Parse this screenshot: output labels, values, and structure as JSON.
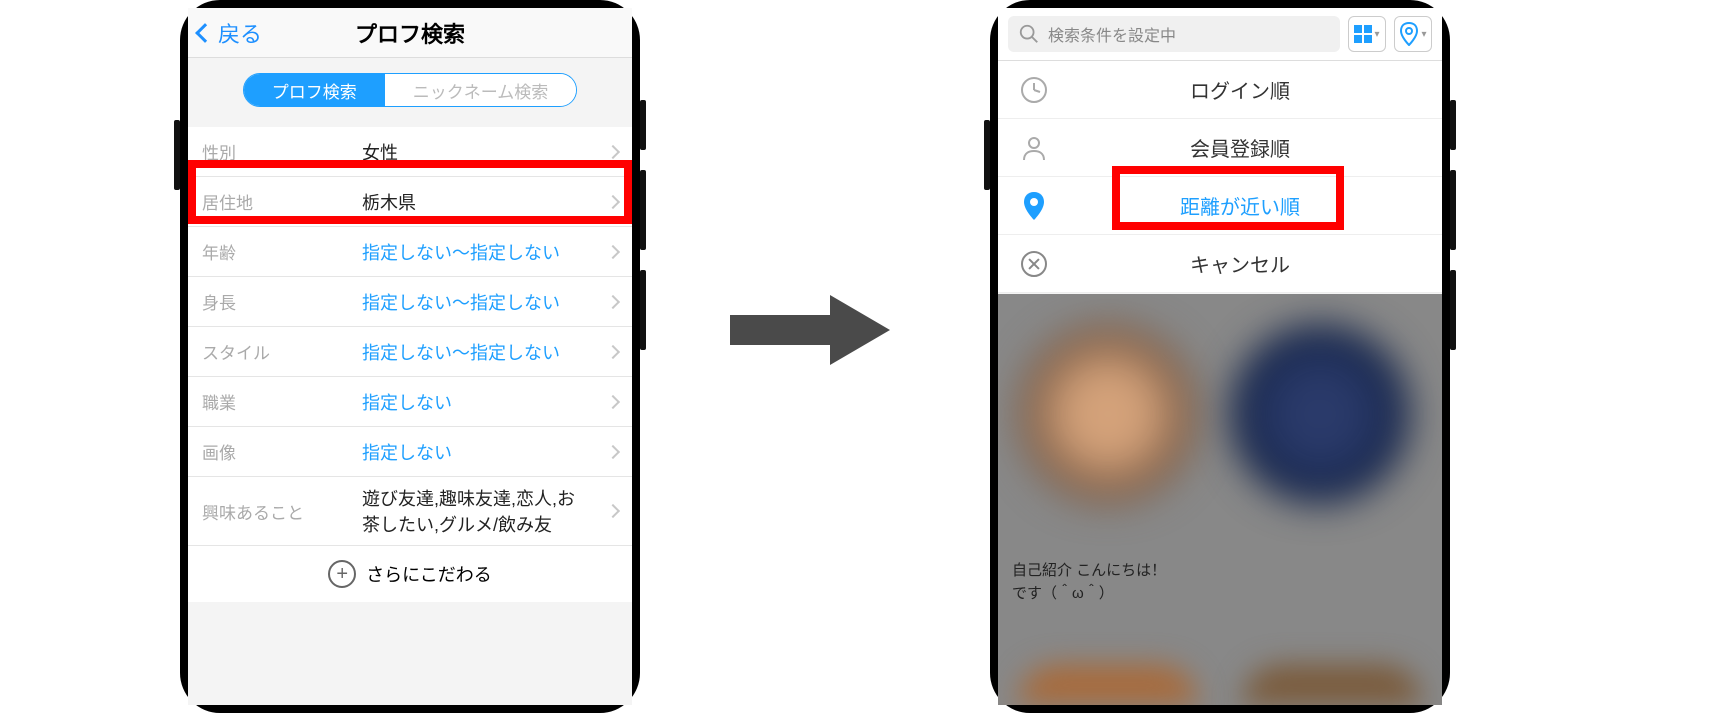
{
  "left": {
    "nav": {
      "back": "戻る",
      "title": "プロフ検索"
    },
    "segments": {
      "profile": "プロフ検索",
      "nickname": "ニックネーム検索"
    },
    "rows": [
      {
        "label": "性別",
        "value": "女性",
        "blue": false
      },
      {
        "label": "居住地",
        "value": "栃木県",
        "blue": false
      },
      {
        "label": "年齢",
        "value": "指定しない～指定しない",
        "blue": true
      },
      {
        "label": "身長",
        "value": "指定しない～指定しない",
        "blue": true
      },
      {
        "label": "スタイル",
        "value": "指定しない～指定しない",
        "blue": true
      },
      {
        "label": "職業",
        "value": "指定しない",
        "blue": true
      },
      {
        "label": "画像",
        "value": "指定しない",
        "blue": true
      },
      {
        "label": "興味あること",
        "value": "遊び友達,趣味友達,恋人,お茶したい,グルメ/飲み友",
        "blue": false
      }
    ],
    "more": "さらにこだわる"
  },
  "right": {
    "search_placeholder": "検索条件を設定中",
    "sort_options": {
      "login": "ログイン順",
      "register": "会員登録順",
      "distance": "距離が近い順",
      "cancel": "キャンセル"
    },
    "caption_line1": "自己紹介 こんにちは！",
    "caption_line2": "です（＾ω＾）"
  }
}
